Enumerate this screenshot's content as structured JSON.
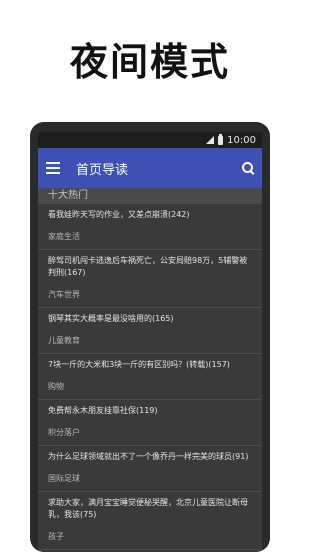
{
  "promo": {
    "title": "夜间模式"
  },
  "statusbar": {
    "time": "10:00"
  },
  "appbar": {
    "title": "首页导读"
  },
  "section": {
    "header": "十大热门"
  },
  "items": [
    {
      "title": "看我娃昨天写的作业，又差点崩溃(242)",
      "category": "家庭生活"
    },
    {
      "title": "醉驾司机闯卡逃逸后车祸死亡，公安局赔98万，5辅警被判刑(167)",
      "category": "汽车世界"
    },
    {
      "title": "钢琴其实大概率是最没啥用的(165)",
      "category": "儿童教育"
    },
    {
      "title": "7块一斤的大米和3块一斤的有区别吗？(转载)(157)",
      "category": "购物"
    },
    {
      "title": "免费帮永木朋友挂靠社保(119)",
      "category": "积分落户"
    },
    {
      "title": "为什么足球领域就出不了一个像乔丹一样完美的球员(91)",
      "category": "国际足球"
    },
    {
      "title": "求助大家，满月宝宝睡觉便秘哭醒，北京儿童医院让断母乳，我该(75)",
      "category": "孩子"
    }
  ],
  "colors": {
    "appbar": "#3f51b5",
    "background": "#3a3a3a"
  }
}
